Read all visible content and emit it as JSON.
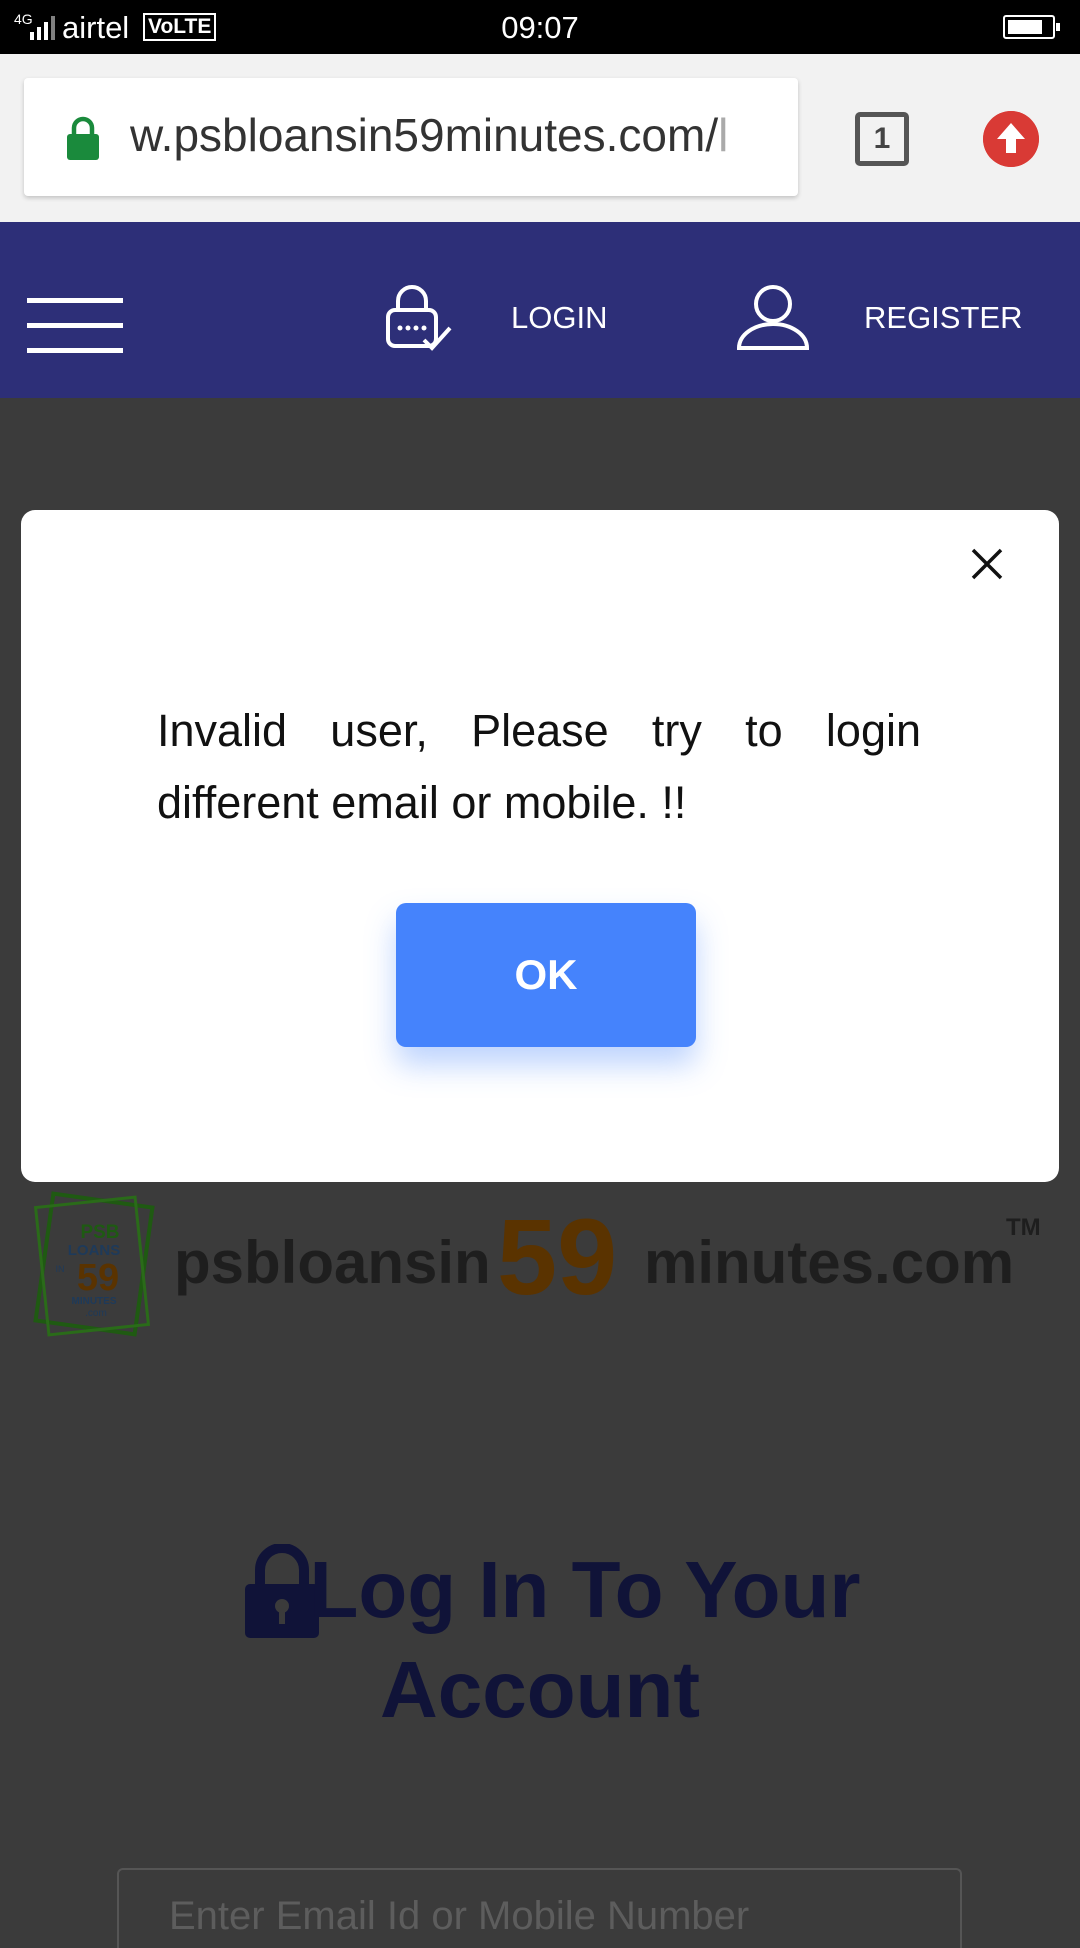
{
  "status_bar": {
    "network": "4G",
    "carrier": "airtel",
    "volte": "VoLTE",
    "time": "09:07",
    "battery_level": 0.8
  },
  "browser": {
    "url_main": "w.psbloansin59minutes.com/",
    "url_tail": "l",
    "tab_count": "1",
    "secure_icon": "lock-icon",
    "update_icon": "arrow-up-icon"
  },
  "header": {
    "menu_icon": "hamburger-icon",
    "login_label": "LOGIN",
    "register_label": "REGISTER",
    "background": "#2d2f78"
  },
  "page": {
    "logo_badge": {
      "line1": "PSB",
      "line2": "LOANS",
      "line3": "IN",
      "number": "59",
      "line4": "MINUTES",
      "line5": ".com"
    },
    "brand": {
      "prefix": "psbloansin",
      "number": "59",
      "suffix": "minutes.com",
      "trademark": "TM"
    },
    "title_line1": "Log In To Your",
    "title_line2": "Account",
    "email_placeholder": "Enter Email Id or Mobile Number"
  },
  "modal": {
    "message": "Invalid user, Please try to login different email or mobile. !!",
    "ok_label": "OK",
    "accent": "#4583fc"
  }
}
